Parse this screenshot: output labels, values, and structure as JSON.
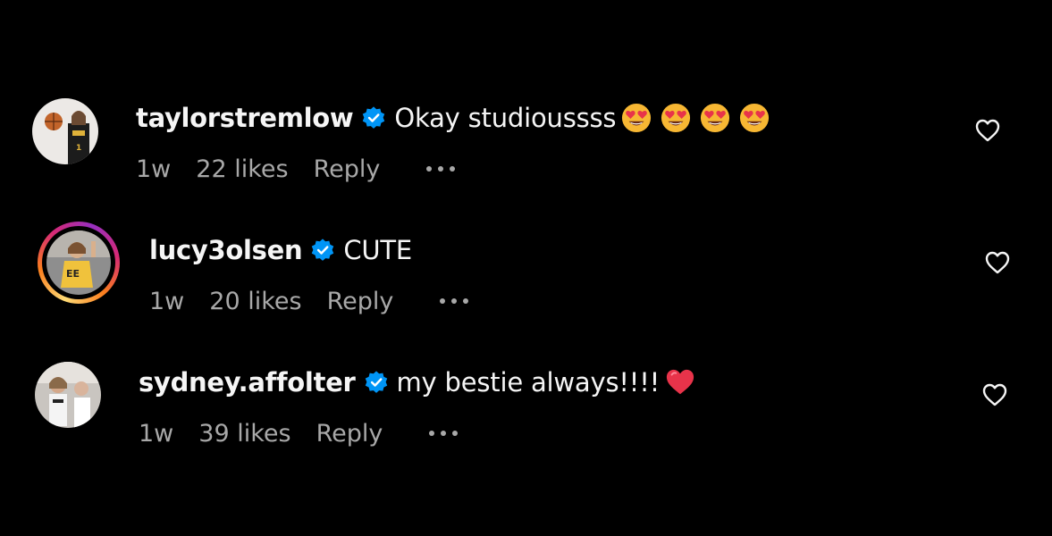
{
  "colors": {
    "background": "#000000",
    "text": "#f5f5f5",
    "secondary_text": "#a8a8a8",
    "verified_blue": "#0095f6",
    "heart_red": "#ff3040"
  },
  "comments": [
    {
      "username": "taylorstremlow",
      "verified": true,
      "text": "Okay studioussss",
      "emojis": [
        "heart-eyes-emoji",
        "heart-eyes-emoji",
        "heart-eyes-emoji",
        "heart-eyes-emoji"
      ],
      "time": "1w",
      "likes": "22 likes",
      "reply": "Reply",
      "has_story_ring": false
    },
    {
      "username": "lucy3olsen",
      "verified": true,
      "text": "CUTE",
      "emojis": [],
      "time": "1w",
      "likes": "20 likes",
      "reply": "Reply",
      "has_story_ring": true
    },
    {
      "username": "sydney.affolter",
      "verified": true,
      "text": "my bestie always!!!!",
      "emojis": [
        "red-heart-emoji"
      ],
      "time": "1w",
      "likes": "39 likes",
      "reply": "Reply",
      "has_story_ring": false
    }
  ]
}
